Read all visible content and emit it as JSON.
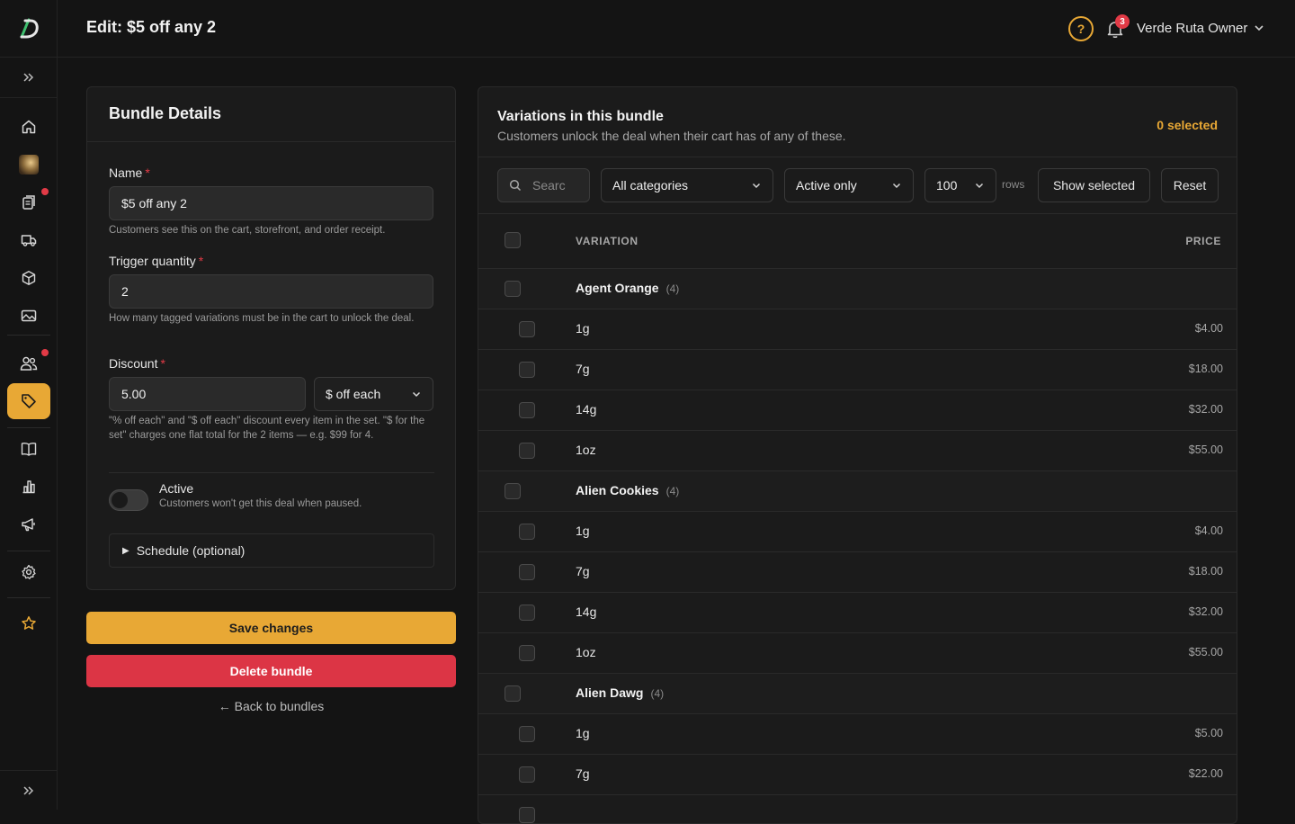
{
  "header": {
    "title": "Edit: $5 off any 2",
    "notification_count": "3",
    "user_name": "Verde Ruta Owner"
  },
  "colors": {
    "accent": "#e8a835",
    "danger": "#dc3545",
    "background": "#141414"
  },
  "sidebar": {
    "items": [
      {
        "icon": "home-icon"
      },
      {
        "icon": "avatar-image-icon"
      },
      {
        "icon": "orders-clipboard-icon",
        "badge": true
      },
      {
        "icon": "delivery-truck-icon"
      },
      {
        "icon": "product-box-icon"
      },
      {
        "icon": "media-image-icon"
      },
      {
        "icon": "customers-users-icon",
        "badge": true
      },
      {
        "icon": "tag-icon",
        "active": true
      },
      {
        "icon": "book-icon"
      },
      {
        "icon": "bar-chart-icon"
      },
      {
        "icon": "megaphone-icon"
      },
      {
        "icon": "settings-gear-icon"
      },
      {
        "icon": "star-icon"
      }
    ]
  },
  "bundle": {
    "card_title": "Bundle Details",
    "name_label": "Name",
    "name_value": "$5 off any 2",
    "name_help": "Customers see this on the cart, storefront, and order receipt.",
    "trigger_label": "Trigger quantity",
    "trigger_value": "2",
    "trigger_help": "How many tagged variations must be in the cart to unlock the deal.",
    "discount_label": "Discount",
    "discount_value": "5.00",
    "discount_type": "$ off each",
    "discount_help": "\"% off each\" and \"$ off each\" discount every item in the set. \"$ for the set\" charges one flat total for the 2 items — e.g. $99 for 4.",
    "active_label": "Active",
    "active_help": "Customers won't get this deal when paused.",
    "active_on": false,
    "schedule_label": "Schedule (optional)",
    "required_mark": "*"
  },
  "actions": {
    "save_label": "Save changes",
    "delete_label": "Delete bundle",
    "back_label": "← Back to bundles"
  },
  "variations": {
    "title": "Variations in this bundle",
    "subtitle": "Customers unlock the deal when their cart has of any of these.",
    "selected_text": "0 selected",
    "search_placeholder": "Searc",
    "category_filter": "All categories",
    "status_filter": "Active only",
    "rows_value": "100",
    "rows_label": "rows",
    "show_selected_label": "Show selected",
    "reset_label": "Reset",
    "col_variation": "VARIATION",
    "col_price": "PRICE",
    "rows": [
      {
        "type": "group",
        "name": "Agent Orange",
        "count": "(4)"
      },
      {
        "type": "item",
        "name": "1g",
        "price": "$4.00"
      },
      {
        "type": "item",
        "name": "7g",
        "price": "$18.00"
      },
      {
        "type": "item",
        "name": "14g",
        "price": "$32.00"
      },
      {
        "type": "item",
        "name": "1oz",
        "price": "$55.00"
      },
      {
        "type": "group",
        "name": "Alien Cookies",
        "count": "(4)"
      },
      {
        "type": "item",
        "name": "1g",
        "price": "$4.00"
      },
      {
        "type": "item",
        "name": "7g",
        "price": "$18.00"
      },
      {
        "type": "item",
        "name": "14g",
        "price": "$32.00"
      },
      {
        "type": "item",
        "name": "1oz",
        "price": "$55.00"
      },
      {
        "type": "group",
        "name": "Alien Dawg",
        "count": "(4)"
      },
      {
        "type": "item",
        "name": "1g",
        "price": "$5.00"
      },
      {
        "type": "item",
        "name": "7g",
        "price": "$22.00"
      },
      {
        "type": "item",
        "name": "",
        "price": ""
      }
    ]
  }
}
